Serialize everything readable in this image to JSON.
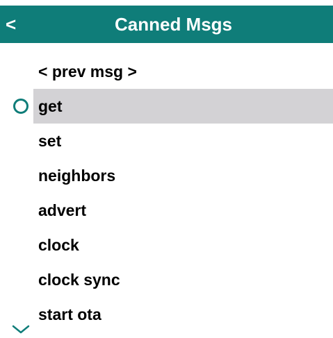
{
  "header": {
    "back_label": "<",
    "title": "Canned Msgs",
    "background_color": "#0f7d79"
  },
  "menu": {
    "selected_index": 1,
    "highlight_color": "#d3d2d5",
    "items": [
      {
        "label": "< prev msg >"
      },
      {
        "label": "get"
      },
      {
        "label": "set"
      },
      {
        "label": "neighbors"
      },
      {
        "label": "advert"
      },
      {
        "label": "clock"
      },
      {
        "label": "clock sync"
      },
      {
        "label": "start ota"
      }
    ]
  },
  "icons": {
    "selector": "ring-selector-icon",
    "scroll": "chevron-down-icon"
  }
}
